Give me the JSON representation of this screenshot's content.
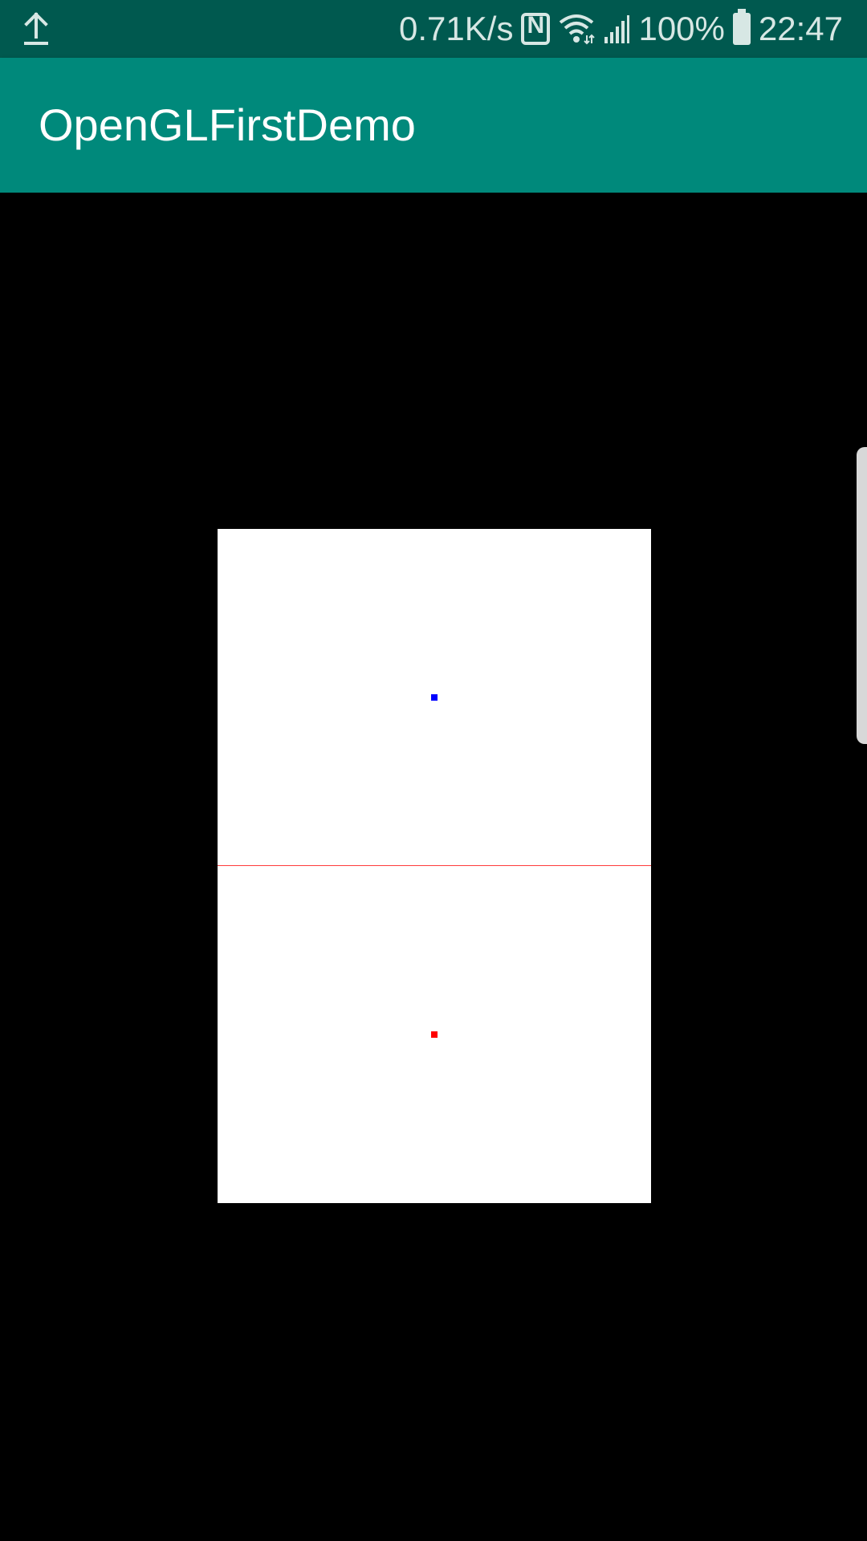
{
  "status_bar": {
    "net_speed": "0.71K/s",
    "battery": "100%",
    "time": "22:47",
    "icons": [
      "upload-icon",
      "nfc-icon",
      "wifi-icon",
      "signal-icon",
      "battery-icon"
    ]
  },
  "app_bar": {
    "title": "OpenGLFirstDemo"
  },
  "gl_scene": {
    "background": "#000000",
    "surface_color": "#ffffff",
    "line_color": "#ff3b3b",
    "point_top_color": "#0000ff",
    "point_bottom_color": "#ff0000"
  },
  "colors": {
    "status_bar": "#00594f",
    "app_bar": "#00897b"
  }
}
